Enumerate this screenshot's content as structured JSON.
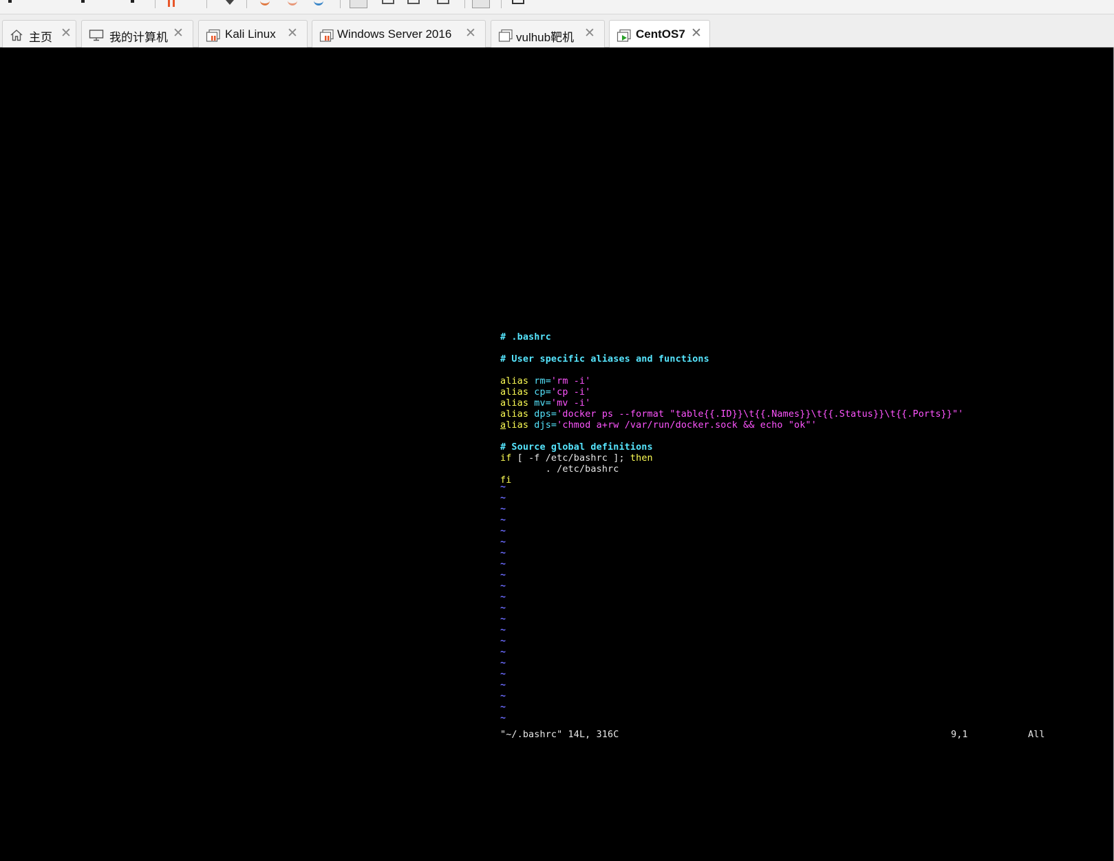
{
  "tabs": [
    {
      "label": "主页",
      "icon": "home-icon",
      "active": false
    },
    {
      "label": "我的计算机",
      "icon": "computer-icon",
      "active": false
    },
    {
      "label": "Kali Linux",
      "icon": "vm-icon",
      "active": false
    },
    {
      "label": "Windows Server 2016",
      "icon": "vm-icon",
      "active": false
    },
    {
      "label": "vulhub靶机",
      "icon": "vm-icon",
      "active": false
    },
    {
      "label": "CentOS7",
      "icon": "vm-running-icon",
      "active": true
    }
  ],
  "tab_close_glyph": "✕",
  "terminal": {
    "comment1": "# .bashrc",
    "comment2": "# User specific aliases and functions",
    "alias_kw": "alias",
    "alias_rm_name": "rm=",
    "alias_rm_val": "'rm -i'",
    "alias_cp_name": "cp=",
    "alias_cp_val": "'cp -i'",
    "alias_mv_name": "mv=",
    "alias_mv_val": "'mv -i'",
    "alias_dps_name": "dps=",
    "alias_dps_val": "'docker ps --format \"table{{.ID}}\\t{{.Names}}\\t{{.Status}}\\t{{.Ports}}\"'",
    "alias_djs_first": "a",
    "alias_djs_rest": "lias",
    "alias_djs_name": "djs=",
    "alias_djs_val": "'chmod a+rw /var/run/docker.sock && echo \"ok\"'",
    "comment3": "# Source global definitions",
    "if_kw": "if",
    "if_cond": " [ -f /etc/bashrc ]; ",
    "then_kw": "then",
    "source_line": "        . /etc/bashrc",
    "fi_kw": "fi",
    "tilde": "~",
    "status_file": "\"~/.bashrc\" 14L, 316C",
    "status_pos": "9,1",
    "status_all": "All"
  },
  "colors": {
    "console_bg": "#000000",
    "comment": "#56e6ff",
    "keyword": "#ffff55",
    "string": "#ff55ff",
    "text": "#e8e8e8",
    "tilde": "#6b6bff"
  }
}
